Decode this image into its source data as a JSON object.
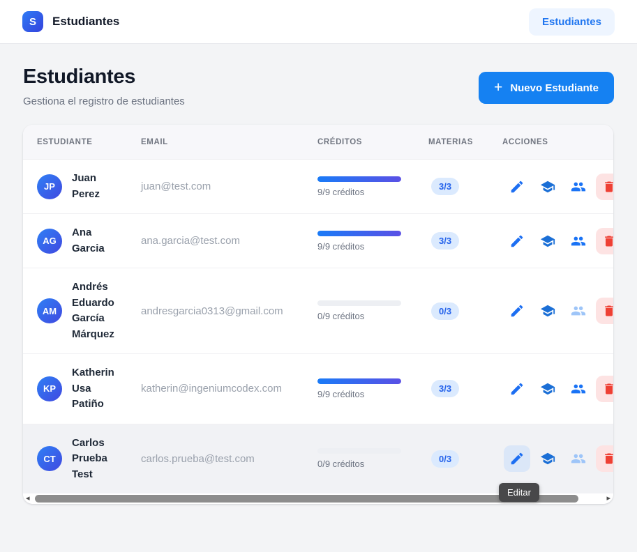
{
  "topbar": {
    "logo_letter": "S",
    "app_title": "Estudiantes",
    "nav_button": "Estudiantes"
  },
  "header": {
    "title": "Estudiantes",
    "subtitle": "Gestiona el registro de estudiantes",
    "new_button": "Nuevo Estudiante"
  },
  "icons": {
    "plus": "+",
    "left_arrow": "◂",
    "right_arrow": "▸"
  },
  "table": {
    "columns": [
      "Estudiante",
      "Email",
      "Créditos",
      "Materias",
      "Acciones"
    ],
    "rows": [
      {
        "initials": "JP",
        "name": "Juan Perez",
        "email": "juan@test.com",
        "credits_label": "9/9 créditos",
        "credits_pct": 100,
        "materias": "3/3",
        "people_enabled": true,
        "row_hover": false,
        "edit_hover": false
      },
      {
        "initials": "AG",
        "name": "Ana Garcia",
        "email": "ana.garcia@test.com",
        "credits_label": "9/9 créditos",
        "credits_pct": 100,
        "materias": "3/3",
        "people_enabled": true,
        "row_hover": false,
        "edit_hover": false
      },
      {
        "initials": "AM",
        "name": "Andrés Eduardo García Márquez",
        "email": "andresgarcia0313@gmail.com",
        "credits_label": "0/9 créditos",
        "credits_pct": 0,
        "materias": "0/3",
        "people_enabled": false,
        "row_hover": false,
        "edit_hover": false
      },
      {
        "initials": "KP",
        "name": "Katherin Usa Patiño",
        "email": "katherin@ingeniumcodex.com",
        "credits_label": "9/9 créditos",
        "credits_pct": 100,
        "materias": "3/3",
        "people_enabled": true,
        "row_hover": false,
        "edit_hover": false
      },
      {
        "initials": "CT",
        "name": "Carlos Prueba Test",
        "email": "carlos.prueba@test.com",
        "credits_label": "0/9 créditos",
        "credits_pct": 0,
        "materias": "0/3",
        "people_enabled": false,
        "row_hover": true,
        "edit_hover": true
      }
    ],
    "tooltip": "Editar"
  },
  "colors": {
    "accent_blue": "#1581f2",
    "nav_pill_bg": "#eef5ff",
    "badge_bg": "#dbeafe",
    "badge_text": "#2563eb",
    "progress_start": "#1a7bf7",
    "progress_end": "#5a50e5",
    "danger_red": "#ee4034",
    "danger_bg": "#fde3e3",
    "disabled_icon": "#9ec5f8"
  }
}
